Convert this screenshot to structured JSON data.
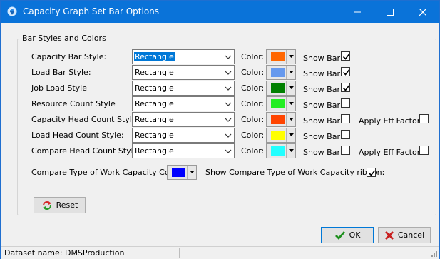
{
  "window": {
    "title": "Capacity Graph Set Bar Options",
    "titlebar_color": "#0a73d9"
  },
  "group": {
    "title": "Bar Styles and Colors"
  },
  "common": {
    "color_label": "Color:",
    "show_bar_label": "Show Bar:",
    "apply_eff_label": "Apply Eff Factor:"
  },
  "rows": [
    {
      "label": "Capacity Bar Style:",
      "style": "Rectangle",
      "color": "#ff6600",
      "show_bar": true,
      "has_eff": false,
      "eff": false,
      "selected": true
    },
    {
      "label": "Load Bar Style:",
      "style": "Rectangle",
      "color": "#6699ee",
      "show_bar": true,
      "has_eff": false,
      "eff": false,
      "selected": false
    },
    {
      "label": "Job Load Style",
      "style": "Rectangle",
      "color": "#008000",
      "show_bar": true,
      "has_eff": false,
      "eff": false,
      "selected": false
    },
    {
      "label": "Resource Count Style",
      "style": "Rectangle",
      "color": "#22ee22",
      "show_bar": false,
      "has_eff": false,
      "eff": false,
      "selected": false
    },
    {
      "label": "Capacity Head Count Style:",
      "style": "Rectangle",
      "color": "#ff4400",
      "show_bar": false,
      "has_eff": true,
      "eff": false,
      "selected": false
    },
    {
      "label": "Load Head Count Style:",
      "style": "Rectangle",
      "color": "#ffff00",
      "show_bar": false,
      "has_eff": false,
      "eff": false,
      "selected": false
    },
    {
      "label": "Compare Head Count Style:",
      "style": "Rectangle",
      "color": "#22ffff",
      "show_bar": false,
      "has_eff": true,
      "eff": false,
      "selected": false
    }
  ],
  "compare": {
    "label": "Compare Type of Work Capacity Color:",
    "color": "#0000ff",
    "ribbon_label": "Show Compare Type of Work Capacity ribbon:",
    "ribbon_checked": true
  },
  "buttons": {
    "reset": "Reset",
    "ok": "OK",
    "cancel": "Cancel"
  },
  "status": {
    "text": "Dataset name:  DMSProduction"
  },
  "icons": {
    "app": "diamond-app-icon",
    "minimize": "minimize-icon",
    "maximize": "maximize-icon",
    "close": "close-icon",
    "reset": "reset-refresh-icon",
    "ok": "green-check-icon",
    "cancel": "red-x-icon",
    "grip": "resize-grip-icon"
  }
}
